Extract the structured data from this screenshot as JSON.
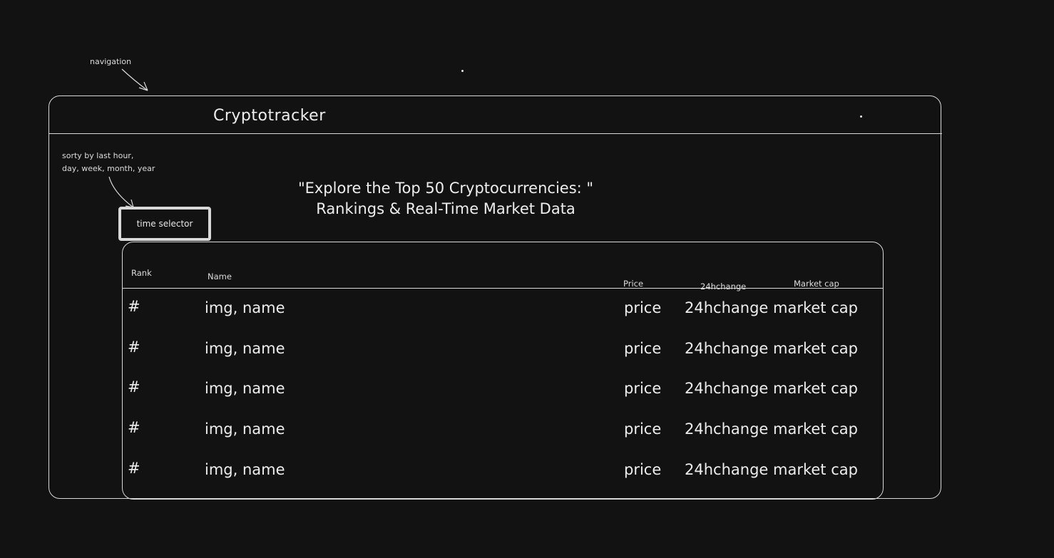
{
  "annotations": {
    "navigation": "navigation",
    "sort_note_line1": "sorty by last hour,",
    "sort_note_line2": "day, week, month, year"
  },
  "nav": {
    "title": "Cryptotracker"
  },
  "controls": {
    "time_selector_label": "time selector"
  },
  "hero": {
    "line1": "\"Explore the Top 50 Cryptocurrencies: \"",
    "line2": "Rankings & Real-Time Market Data"
  },
  "table": {
    "headers": {
      "rank": "Rank",
      "name": "Name",
      "price": "Price",
      "change": "24hchange",
      "market_cap": "Market cap"
    },
    "rows": [
      {
        "rank": "#",
        "name": "img, name",
        "price": "price",
        "change": "24hchange",
        "market_cap": "market cap"
      },
      {
        "rank": "#",
        "name": "img, name",
        "price": "price",
        "change": "24hchange",
        "market_cap": "market cap"
      },
      {
        "rank": "#",
        "name": "img, name",
        "price": "price",
        "change": "24hchange",
        "market_cap": "market cap"
      },
      {
        "rank": "#",
        "name": "img, name",
        "price": "price",
        "change": "24hchange",
        "market_cap": "market cap"
      },
      {
        "rank": "#",
        "name": "img, name",
        "price": "price",
        "change": "24hchange",
        "market_cap": "market cap"
      }
    ]
  },
  "colors": {
    "background": "#121212",
    "stroke": "#d8d8d8",
    "text": "#ededed"
  }
}
